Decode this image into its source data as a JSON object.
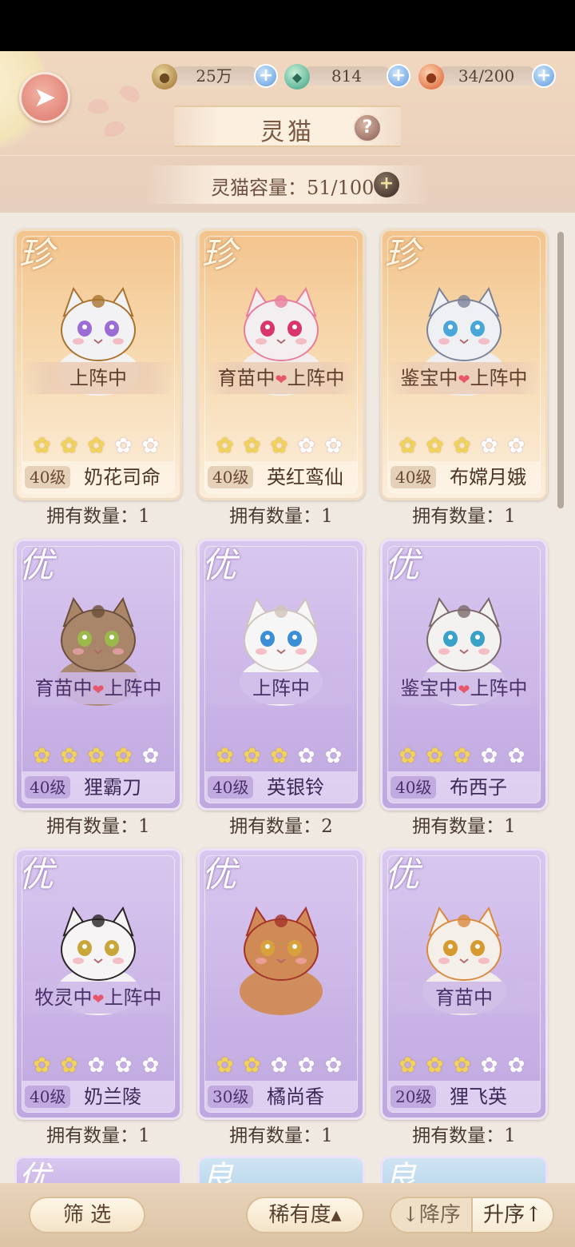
{
  "resources": [
    {
      "icon": "paw-coin-icon",
      "value": "25万"
    },
    {
      "icon": "jade-icon",
      "value": "814"
    },
    {
      "icon": "food-bowl-icon",
      "value": "34/200"
    }
  ],
  "header": {
    "title": "灵猫",
    "help": "?",
    "capacity": "灵猫容量：51/100"
  },
  "cards": [
    {
      "rarity": "珍",
      "tier": "gold",
      "status": "上阵中",
      "stars": 3,
      "level": "40级",
      "name": "奶花司命",
      "owned": "拥有数量：1",
      "fur": "#f2f2f4",
      "accent": "#a8742f",
      "eye": "#9b6bd6"
    },
    {
      "rarity": "珍",
      "tier": "gold",
      "status_left": "育苗中",
      "status_right": "上阵中",
      "stars": 3,
      "level": "40级",
      "name": "英红鸾仙",
      "owned": "拥有数量：1",
      "fur": "#f3eef0",
      "accent": "#e87d9a",
      "eye": "#d8366b"
    },
    {
      "rarity": "珍",
      "tier": "gold",
      "status_left": "鉴宝中",
      "status_right": "上阵中",
      "stars": 3,
      "level": "40级",
      "name": "布嫦月娥",
      "owned": "拥有数量：1",
      "fur": "#eef0f4",
      "accent": "#7c8297",
      "eye": "#49a6d8"
    },
    {
      "rarity": "优",
      "tier": "purple",
      "status_left": "育苗中",
      "status_right": "上阵中",
      "stars": 4,
      "level": "40级",
      "name": "狸霸刀",
      "owned": "拥有数量：1",
      "fur": "#a9866a",
      "accent": "#6b4f3a",
      "eye": "#9bb84a"
    },
    {
      "rarity": "优",
      "tier": "purple",
      "status": "上阵中",
      "stars": 3,
      "level": "40级",
      "name": "英银铃",
      "owned": "拥有数量：2",
      "fur": "#f7f6f6",
      "accent": "#cfc4bd",
      "eye": "#3c8fd6"
    },
    {
      "rarity": "优",
      "tier": "purple",
      "status_left": "鉴宝中",
      "status_right": "上阵中",
      "stars": 3,
      "level": "40级",
      "name": "布西子",
      "owned": "拥有数量：1",
      "fur": "#f4f2f1",
      "accent": "#7b6a69",
      "eye": "#3aa1c9"
    },
    {
      "rarity": "优",
      "tier": "purple",
      "status_left": "牧灵中",
      "status_right": "上阵中",
      "stars": 2,
      "level": "40级",
      "name": "奶兰陵",
      "owned": "拥有数量：1",
      "fur": "#f6f4f4",
      "accent": "#2b2426",
      "eye": "#c9a63a"
    },
    {
      "rarity": "优",
      "tier": "purple",
      "status": "",
      "stars": 2,
      "level": "30级",
      "name": "橘尚香",
      "owned": "拥有数量：1",
      "fur": "#d08a55",
      "accent": "#a4322b",
      "eye": "#d7a23c"
    },
    {
      "rarity": "优",
      "tier": "purple",
      "status": "育苗中",
      "stars": 3,
      "level": "20级",
      "name": "狸飞英",
      "owned": "拥有数量：1",
      "fur": "#f4efe9",
      "accent": "#d98a3f",
      "eye": "#d69a2f"
    }
  ],
  "partial_rarities": [
    "优",
    "良",
    "良"
  ],
  "bottom": {
    "filter": "筛 选",
    "rarity_sort": "稀有度▴",
    "desc": "↓降序",
    "asc": "升序↑"
  },
  "colors": {
    "header_bg": "#ecd3be",
    "content_bg": "#efe9e2",
    "gold_card": "#f3c48d",
    "purple_card": "#cdb7e8",
    "star_on": "#f2d35a"
  }
}
